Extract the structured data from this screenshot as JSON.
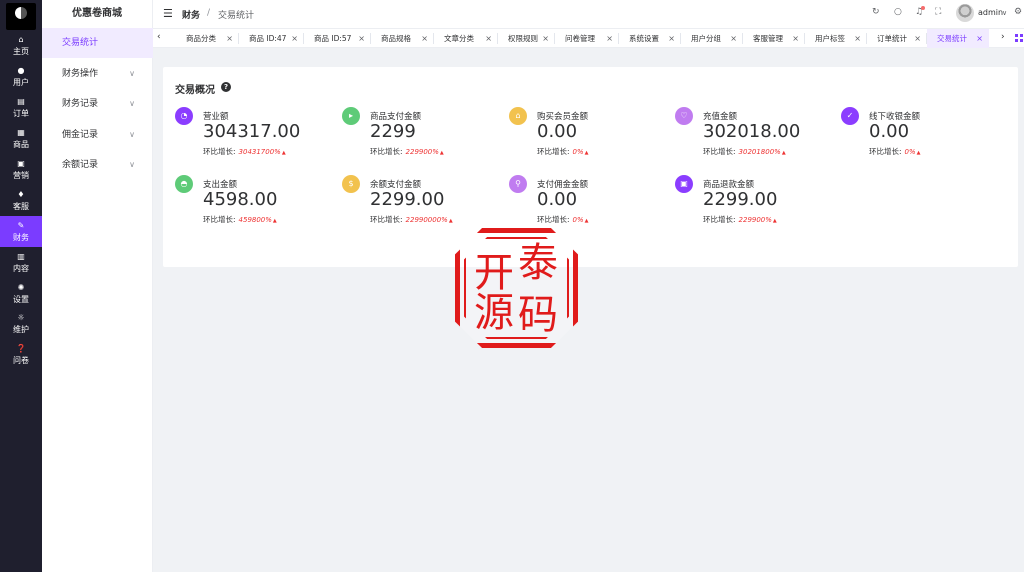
{
  "rail": {
    "items": [
      {
        "label": "主页",
        "icon": "home-icon",
        "glyph": "⌂"
      },
      {
        "label": "用户",
        "icon": "user-icon",
        "glyph": "●"
      },
      {
        "label": "订单",
        "icon": "order-icon",
        "glyph": "▤"
      },
      {
        "label": "商品",
        "icon": "goods-icon",
        "glyph": "▦"
      },
      {
        "label": "营销",
        "icon": "marketing-icon",
        "glyph": "▣"
      },
      {
        "label": "客服",
        "icon": "service-icon",
        "glyph": "♦"
      },
      {
        "label": "财务",
        "icon": "finance-icon",
        "glyph": "✎"
      },
      {
        "label": "内容",
        "icon": "content-icon",
        "glyph": "▥"
      },
      {
        "label": "设置",
        "icon": "settings-icon",
        "glyph": "✺"
      },
      {
        "label": "维护",
        "icon": "maintain-icon",
        "glyph": "☼"
      },
      {
        "label": "问卷",
        "icon": "survey-icon",
        "glyph": "❓"
      }
    ]
  },
  "side": {
    "brand": "优惠卷商城",
    "items": [
      {
        "label": "交易统计"
      },
      {
        "label": "财务操作"
      },
      {
        "label": "财务记录"
      },
      {
        "label": "佣金记录"
      },
      {
        "label": "余额记录"
      }
    ]
  },
  "header": {
    "crumb_parent": "财务",
    "crumb_sep": "/",
    "crumb_current": "交易统计",
    "user": "admin"
  },
  "tabs": [
    {
      "label": "商品分类"
    },
    {
      "label": "商品 ID:47"
    },
    {
      "label": "商品 ID:57"
    },
    {
      "label": "商品规格"
    },
    {
      "label": "文章分类"
    },
    {
      "label": "权限规则"
    },
    {
      "label": "问卷管理"
    },
    {
      "label": "系统设置"
    },
    {
      "label": "用户分组"
    },
    {
      "label": "客服管理"
    },
    {
      "label": "用户标签"
    },
    {
      "label": "订单统计"
    },
    {
      "label": "交易统计"
    }
  ],
  "overview": {
    "title": "交易概况",
    "growth_label": "环比增长:",
    "metrics": [
      {
        "label": "营业额",
        "value": "304317.00",
        "growth": "30431700%",
        "icon": "revenue-icon",
        "color": "#8b3dff"
      },
      {
        "label": "商品支付金额",
        "value": "2299",
        "growth": "229900%",
        "icon": "goods-pay-icon",
        "color": "#5ecb78"
      },
      {
        "label": "购买会员金额",
        "value": "0.00",
        "growth": "0%",
        "icon": "member-icon",
        "color": "#f2c24e"
      },
      {
        "label": "充值金额",
        "value": "302018.00",
        "growth": "30201800%",
        "icon": "recharge-icon",
        "color": "#c07cf0"
      },
      {
        "label": "线下收银金额",
        "value": "0.00",
        "growth": "0%",
        "icon": "offline-icon",
        "color": "#8b3dff"
      },
      {
        "label": "支出金额",
        "value": "4598.00",
        "growth": "459800%",
        "icon": "expense-icon",
        "color": "#5ecb78"
      },
      {
        "label": "余额支付金额",
        "value": "2299.00",
        "growth": "22990000%",
        "icon": "balance-pay-icon",
        "color": "#f2c24e"
      },
      {
        "label": "支付佣金金额",
        "value": "0.00",
        "growth": "0%",
        "icon": "commission-icon",
        "color": "#c07cf0"
      },
      {
        "label": "商品退款金额",
        "value": "2299.00",
        "growth": "229900%",
        "icon": "refund-icon",
        "color": "#8b3dff"
      }
    ]
  },
  "seal": {
    "chars": [
      "开",
      "泰",
      "源",
      "码"
    ]
  }
}
